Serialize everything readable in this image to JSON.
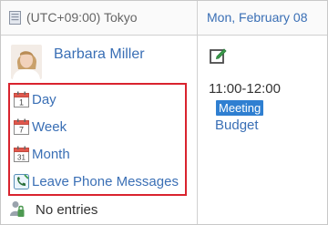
{
  "header": {
    "timezone": "(UTC+09:00) Tokyo",
    "date": "Mon, February 08"
  },
  "user": {
    "name": "Barbara Miller"
  },
  "menu": {
    "items": [
      {
        "label": "Day",
        "icon": "calendar-day-icon",
        "icon_number": "1"
      },
      {
        "label": "Week",
        "icon": "calendar-week-icon",
        "icon_number": "7"
      },
      {
        "label": "Month",
        "icon": "calendar-month-icon",
        "icon_number": "31"
      },
      {
        "label": "Leave Phone Messages",
        "icon": "phone-message-icon"
      }
    ]
  },
  "status": {
    "no_entries": "No entries"
  },
  "schedule": {
    "time": "11:00-12:00",
    "tag": "Meeting",
    "title": "Budget"
  },
  "colors": {
    "link": "#3a6fb5",
    "highlight_border": "#d9232e",
    "tag_bg": "#2f7fd1"
  }
}
